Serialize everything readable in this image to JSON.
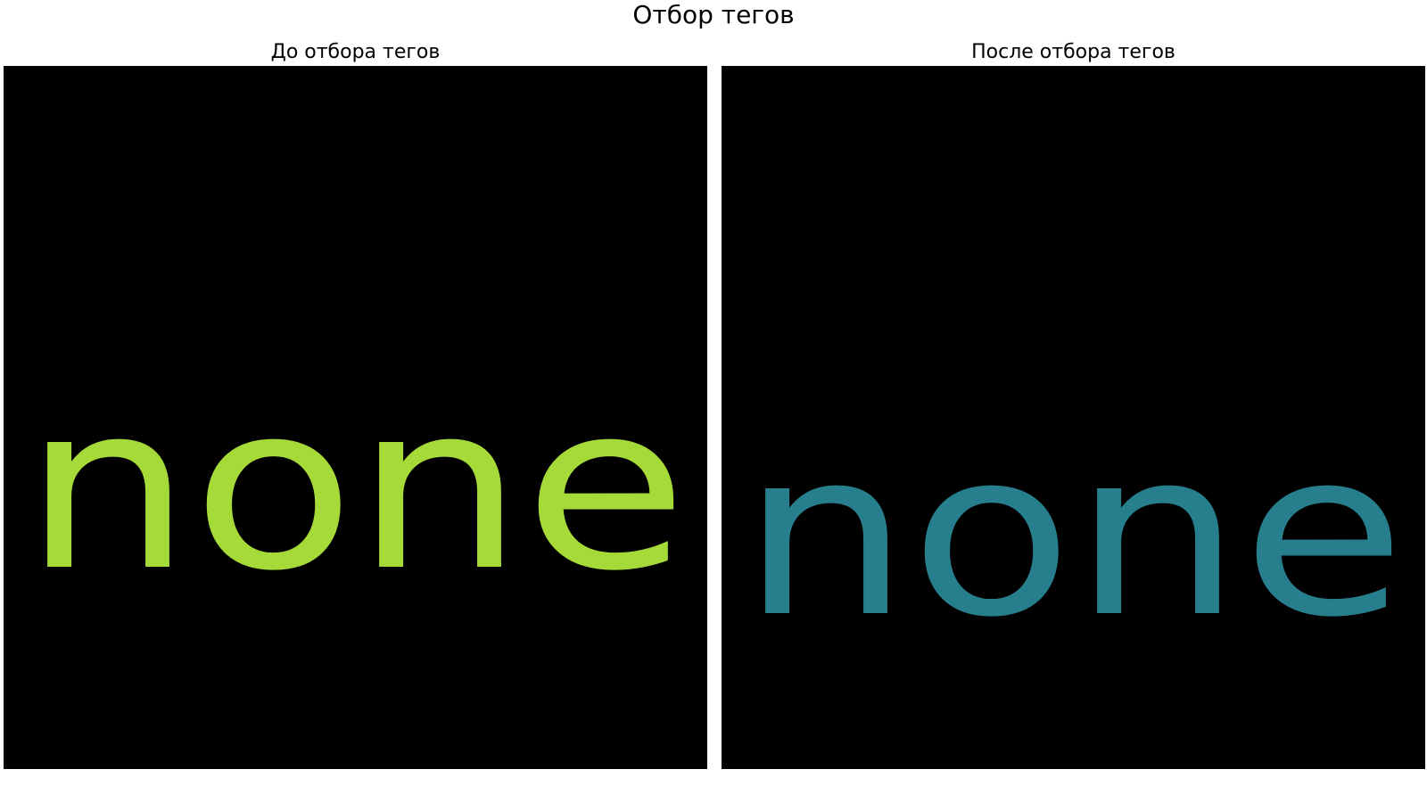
{
  "figure": {
    "title": "Отбор тегов"
  },
  "panels": [
    {
      "title": "До отбора тегов",
      "background_color": "#000000",
      "words": [
        {
          "text": "none",
          "color": "#a5da39"
        }
      ]
    },
    {
      "title": "После отбора тегов",
      "background_color": "#000000",
      "words": [
        {
          "text": "none",
          "color": "#277f8e"
        }
      ]
    }
  ],
  "chart_data": [
    {
      "type": "wordcloud",
      "title": "До отбора тегов",
      "words": [
        {
          "text": "none",
          "weight": 1,
          "color": "#a5da39"
        }
      ]
    },
    {
      "type": "wordcloud",
      "title": "После отбора тегов",
      "words": [
        {
          "text": "none",
          "weight": 1,
          "color": "#277f8e"
        }
      ]
    }
  ]
}
